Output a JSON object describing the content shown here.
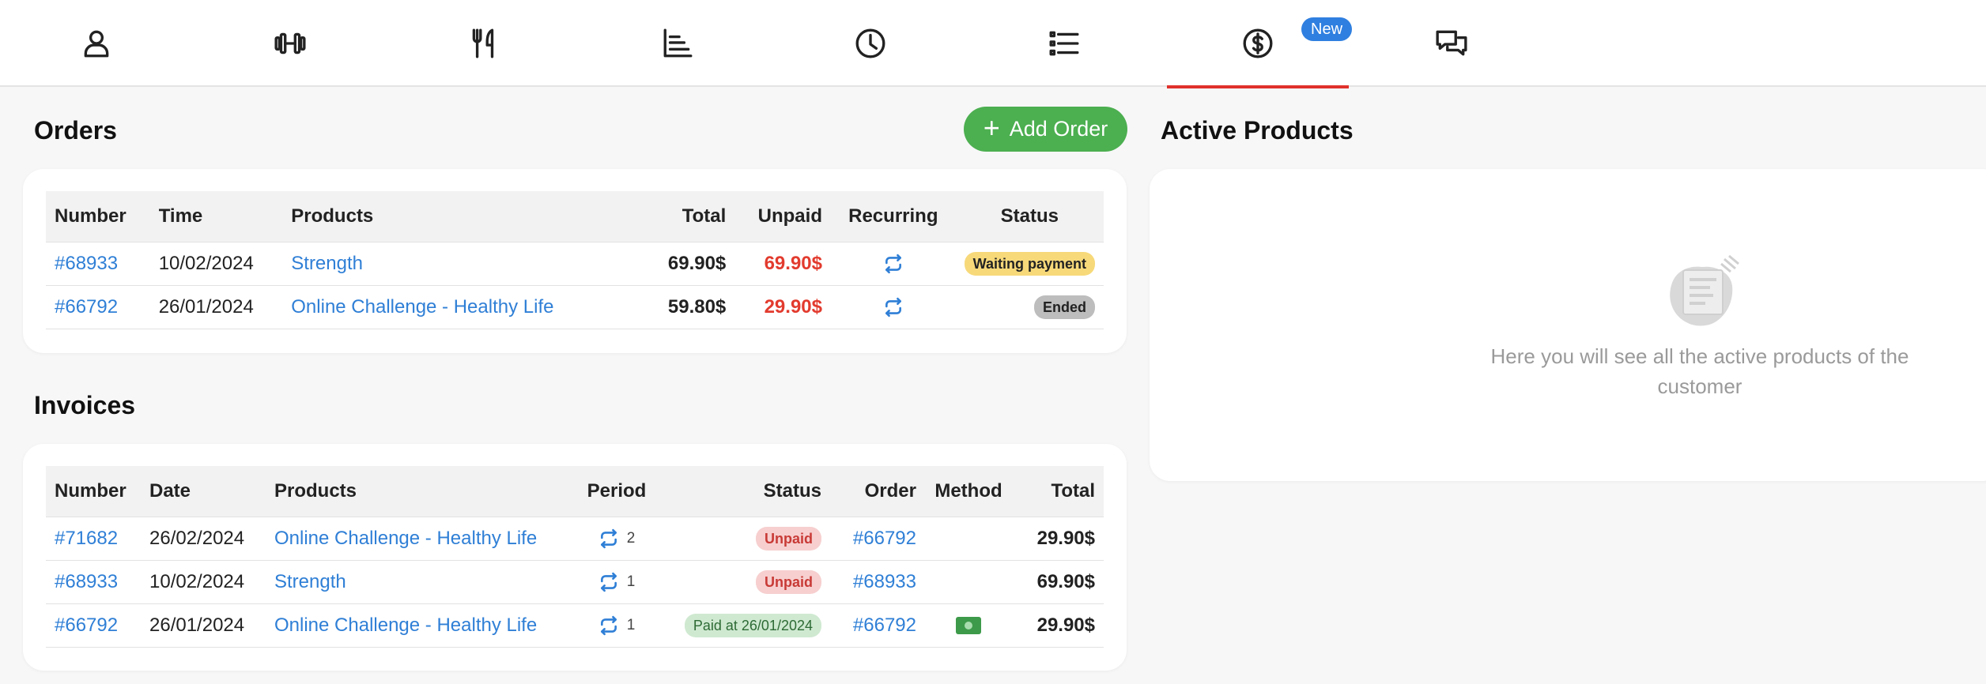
{
  "nav": {
    "tabs": [
      {
        "name": "profile",
        "icon": "user-icon"
      },
      {
        "name": "workouts",
        "icon": "dumbbell-icon"
      },
      {
        "name": "nutrition",
        "icon": "fork-knife-icon"
      },
      {
        "name": "stats",
        "icon": "chart-icon"
      },
      {
        "name": "history",
        "icon": "clock-icon"
      },
      {
        "name": "lists",
        "icon": "list-icon"
      },
      {
        "name": "billing",
        "icon": "dollar-circle-icon",
        "active": true
      },
      {
        "name": "messages",
        "icon": "chat-icon"
      }
    ],
    "new_badge": "New",
    "active_color": "#e0312b"
  },
  "orders": {
    "title": "Orders",
    "add_button": "Add Order",
    "columns": [
      "Number",
      "Time",
      "Products",
      "Total",
      "Unpaid",
      "Recurring",
      "Status"
    ],
    "rows": [
      {
        "number": "#68933",
        "time": "10/02/2024",
        "product": "Strength",
        "total": "69.90$",
        "unpaid": "69.90$",
        "recurring": "recurring-icon",
        "status": "Waiting payment"
      },
      {
        "number": "#66792",
        "time": "26/01/2024",
        "product": "Online Challenge - Healthy Life",
        "total": "59.80$",
        "unpaid": "29.90$",
        "recurring": "recurring-icon",
        "status": "Ended"
      }
    ]
  },
  "invoices": {
    "title": "Invoices",
    "columns": [
      "Number",
      "Date",
      "Products",
      "Period",
      "Status",
      "Order",
      "Method",
      "Total"
    ],
    "rows": [
      {
        "number": "#71682",
        "date": "26/02/2024",
        "product": "Online Challenge - Healthy Life",
        "period": "2",
        "status": "Unpaid",
        "order": "#66792",
        "method": "",
        "total": "29.90$"
      },
      {
        "number": "#68933",
        "date": "10/02/2024",
        "product": "Strength",
        "period": "1",
        "status": "Unpaid",
        "order": "#68933",
        "method": "",
        "total": "69.90$"
      },
      {
        "number": "#66792",
        "date": "26/01/2024",
        "product": "Online Challenge - Healthy Life",
        "period": "1",
        "status": "Paid at 26/01/2024",
        "order": "#66792",
        "method": "cash-icon",
        "total": "29.90$"
      }
    ]
  },
  "active_products": {
    "title": "Active Products",
    "empty_text": "Here you will see all the active products of the customer"
  },
  "colors": {
    "link": "#2f7fd6",
    "primary_button": "#4caf50",
    "unpaid": "#e23b2e",
    "badge_new": "#2f7fe0"
  }
}
